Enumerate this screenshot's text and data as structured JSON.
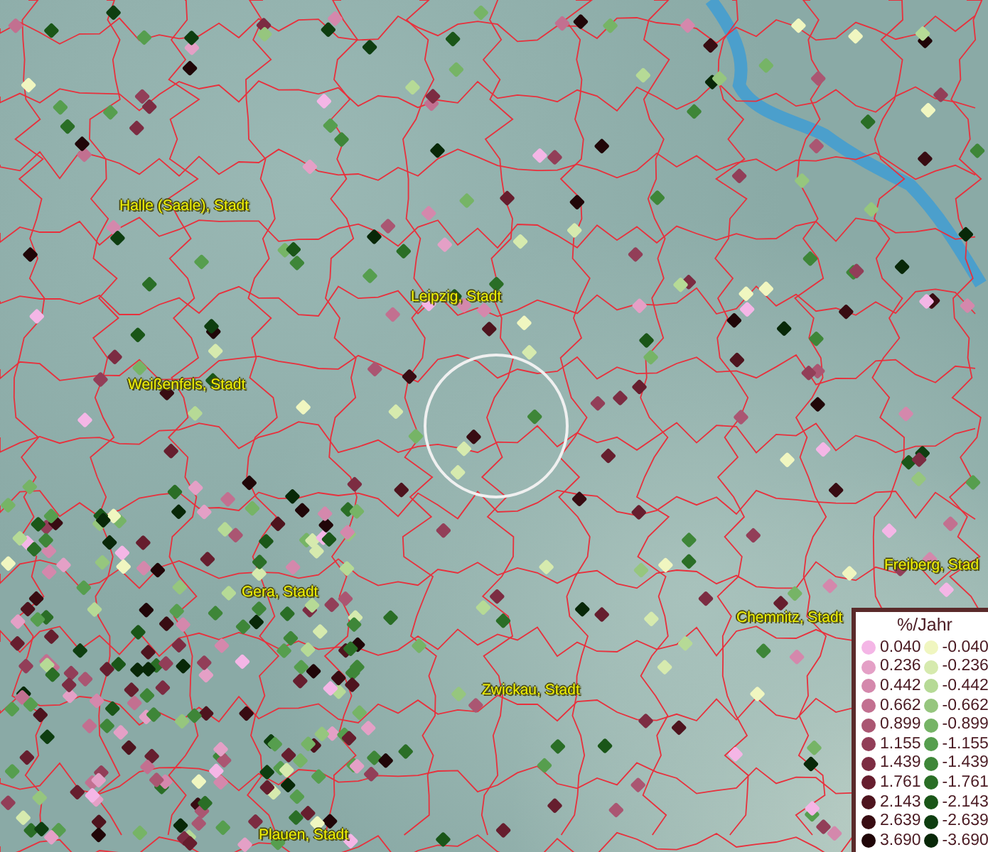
{
  "map": {
    "places": [
      {
        "name": "Halle (Saale), Stadt"
      },
      {
        "name": "Leipzig, Stadt"
      },
      {
        "name": "Weißenfels, Stadt"
      },
      {
        "name": "Gera, Stadt"
      },
      {
        "name": "Chemnitz, Stadt"
      },
      {
        "name": "Freiberg, Stad"
      },
      {
        "name": "Zwickau, Stadt"
      },
      {
        "name": "Plauen, Stadt"
      }
    ]
  },
  "legend": {
    "title": "%/Jahr",
    "columns": [
      {
        "entries": [
          {
            "label": "0.040",
            "color": "#f4b6e6"
          },
          {
            "label": "0.236",
            "color": "#e4a0c6"
          },
          {
            "label": "0.442",
            "color": "#d488ac"
          },
          {
            "label": "0.662",
            "color": "#c27090"
          },
          {
            "label": "0.899",
            "color": "#aa5672"
          },
          {
            "label": "1.155",
            "color": "#923e58"
          },
          {
            "label": "1.439",
            "color": "#7c2c42"
          },
          {
            "label": "1.761",
            "color": "#661e2e"
          },
          {
            "label": "2.143",
            "color": "#4e141e"
          },
          {
            "label": "2.639",
            "color": "#380c12"
          },
          {
            "label": "3.690",
            "color": "#200608"
          }
        ]
      },
      {
        "entries": [
          {
            "label": "-0.040",
            "color": "#f0f6c0"
          },
          {
            "label": "-0.236",
            "color": "#d6eaae"
          },
          {
            "label": "-0.442",
            "color": "#b6da96"
          },
          {
            "label": "-0.662",
            "color": "#96c67e"
          },
          {
            "label": "-0.899",
            "color": "#76b466"
          },
          {
            "label": "-1.155",
            "color": "#569e4e"
          },
          {
            "label": "-1.439",
            "color": "#3e8638"
          },
          {
            "label": "-1.761",
            "color": "#2a6e26"
          },
          {
            "label": "-2.143",
            "color": "#1a5618"
          },
          {
            "label": "-2.639",
            "color": "#0e3e10"
          },
          {
            "label": "-3.690",
            "color": "#082808"
          }
        ]
      }
    ]
  }
}
